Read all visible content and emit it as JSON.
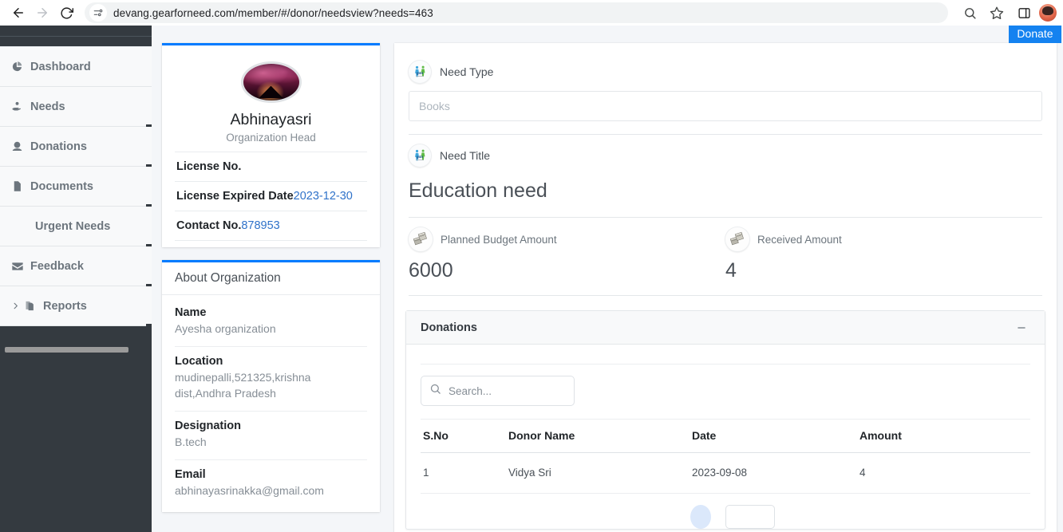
{
  "browser": {
    "url": "devang.gearforneed.com/member/#/donor/needsview?needs=463",
    "back_icon": "back-arrow-icon",
    "forward_icon": "forward-arrow-icon",
    "reload_icon": "reload-icon",
    "site_info_icon": "site-settings-icon",
    "zoom_icon": "search-icon",
    "bookmark_icon": "star-icon",
    "sidepanel_icon": "side-panel-icon",
    "profile_icon": "profile-avatar-icon"
  },
  "sidebar": {
    "items": [
      {
        "label": "Dashboard",
        "icon": "pie-chart-icon",
        "has_icon": true,
        "has_chevron": false
      },
      {
        "label": "Needs",
        "icon": "hand-heart-icon",
        "has_icon": true,
        "has_chevron": false
      },
      {
        "label": "Donations",
        "icon": "donation-person-icon",
        "has_icon": true,
        "has_chevron": false
      },
      {
        "label": "Documents",
        "icon": "document-icon",
        "has_icon": true,
        "has_chevron": false
      },
      {
        "label": "Urgent Needs",
        "icon": "",
        "has_icon": false,
        "has_chevron": false
      },
      {
        "label": "Feedback",
        "icon": "envelope-icon",
        "has_icon": true,
        "has_chevron": false
      },
      {
        "label": "Reports",
        "icon": "reports-icon",
        "has_icon": true,
        "has_chevron": true
      }
    ]
  },
  "header": {
    "donate_label": "Donate",
    "donate_color": "#1482f0"
  },
  "profile": {
    "avatar": "organization-avatar-image",
    "name": "Abhinayasri",
    "role": "Organization Head",
    "details": [
      {
        "label": "License No.",
        "value": ""
      },
      {
        "label": "License Expired Date",
        "value": "2023-12-30"
      },
      {
        "label": "Contact No.",
        "value": "878953"
      }
    ],
    "value_color": "#2f72c9"
  },
  "about": {
    "title": "About Organization",
    "blocks": [
      {
        "label": "Name",
        "value": "Ayesha organization"
      },
      {
        "label": "Location",
        "value": "mudinepalli,521325,krishna dist,Andhra Pradesh"
      },
      {
        "label": "Designation",
        "value": "B.tech"
      },
      {
        "label": "Email",
        "value": "abhinayasrinakka@gmail.com"
      }
    ]
  },
  "need": {
    "type_label": "Need Type",
    "type_value": "Books",
    "title_label": "Need Title",
    "title_value": "Education need",
    "planned_label": "Planned Budget Amount",
    "planned_value": "6000",
    "received_label": "Received Amount",
    "received_value": "4",
    "logo_icon": "gearforneed-logo-icon",
    "money_icon": "money-stack-icon"
  },
  "donations": {
    "card_title": "Donations",
    "collapse_icon": "minus-icon",
    "search_placeholder": "Search...",
    "search_value": "",
    "search_icon": "search-icon",
    "columns": [
      "S.No",
      "Donor Name",
      "Date",
      "Amount"
    ],
    "rows": [
      {
        "sno": "1",
        "donor": "Vidya Sri",
        "date": "2023-09-08",
        "amount": "4"
      }
    ]
  }
}
